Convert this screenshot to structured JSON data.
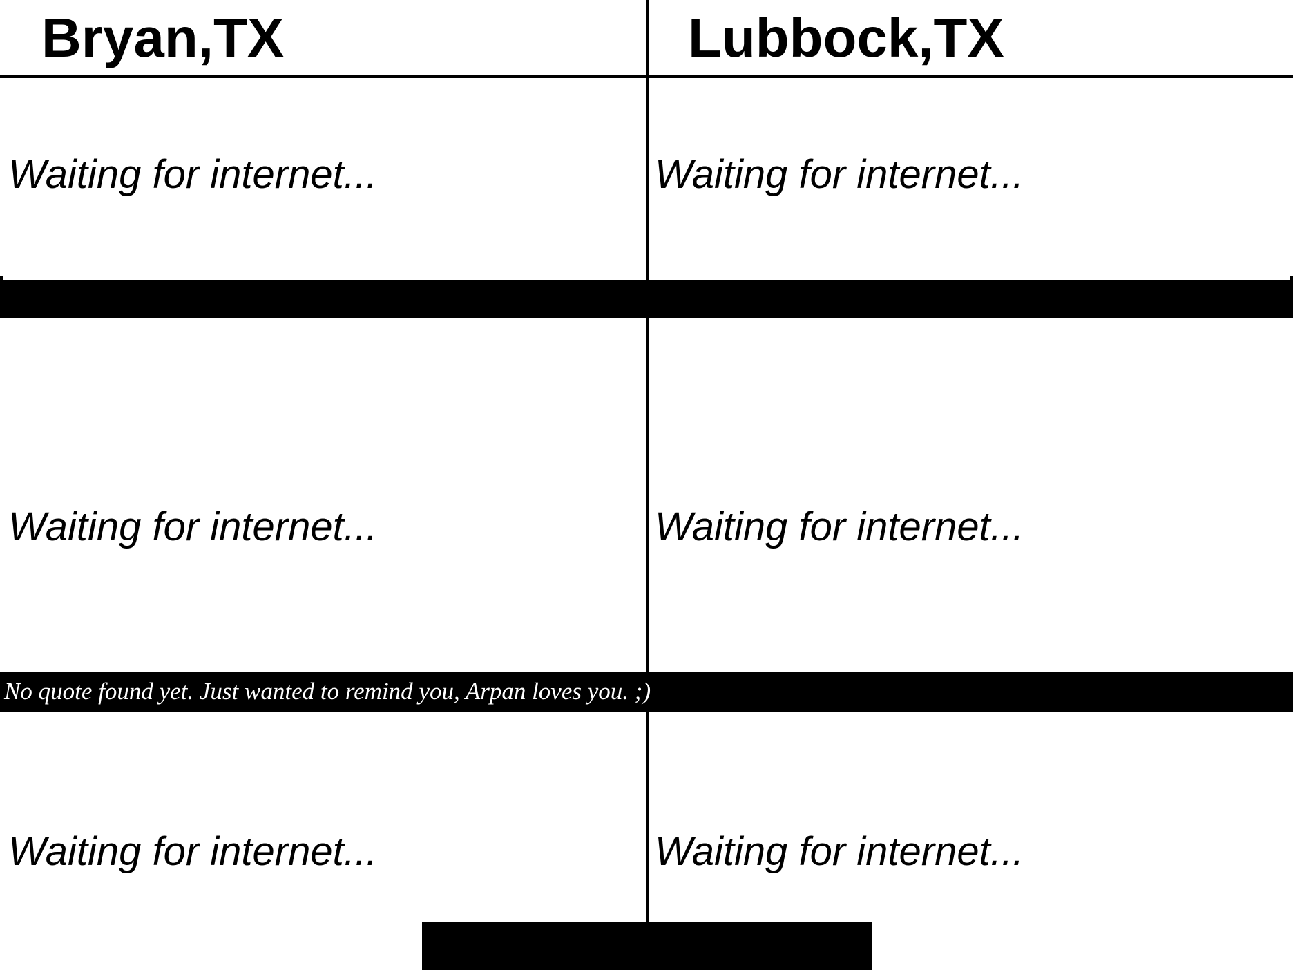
{
  "cities": [
    {
      "name": "Bryan,TX",
      "rows": [
        "Waiting for internet...",
        "Waiting for internet...",
        "Waiting for internet..."
      ]
    },
    {
      "name": "Lubbock,TX",
      "rows": [
        "Waiting for internet...",
        "Waiting for internet...",
        "Waiting for internet..."
      ]
    }
  ],
  "quote": "No quote found yet. Just wanted to remind you, Arpan loves you. ;)",
  "colors": {
    "background": "#ffffff",
    "foreground": "#000000",
    "band_text": "#ffffff"
  }
}
